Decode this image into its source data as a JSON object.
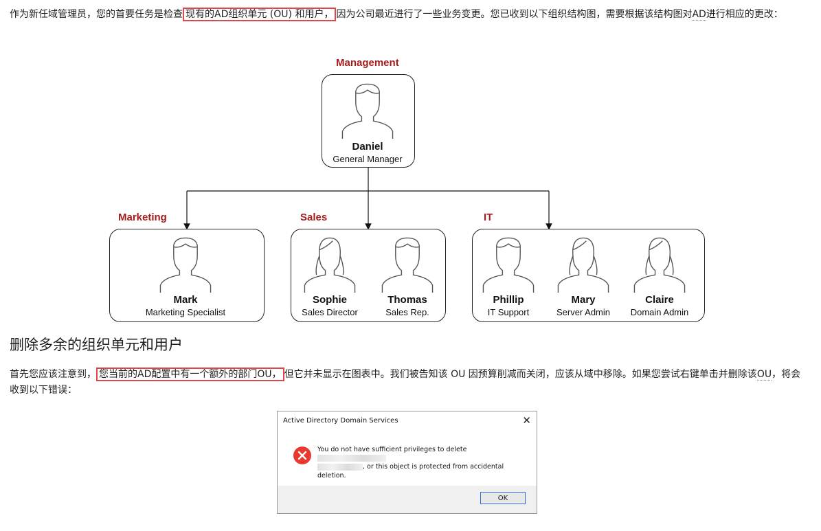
{
  "intro": {
    "before_highlight": "作为新任域管理员，您的首要任务是检查",
    "highlight_pre": "现有的",
    "highlight_ad": "AD",
    "highlight_post": "组织单元 (OU) 和用户，",
    "middle": "因为公司最近进行了一些业务变更。您已收到以下组织结构图，需要根据该结构图对",
    "ad2": "AD",
    "after": "进行相应的更改："
  },
  "org_chart": {
    "departments": [
      {
        "label": "Management"
      },
      {
        "label": "Marketing"
      },
      {
        "label": "Sales"
      },
      {
        "label": "IT"
      }
    ],
    "people": [
      {
        "name": "Daniel",
        "role": "General Manager",
        "icon": "male-avatar-icon"
      },
      {
        "name": "Mark",
        "role": "Marketing Specialist",
        "icon": "male-avatar-icon"
      },
      {
        "name": "Sophie",
        "role": "Sales Director",
        "icon": "female-avatar-icon"
      },
      {
        "name": "Thomas",
        "role": "Sales Rep.",
        "icon": "male-avatar-icon"
      },
      {
        "name": "Phillip",
        "role": "IT Support",
        "icon": "male-avatar-icon"
      },
      {
        "name": "Mary",
        "role": "Server Admin",
        "icon": "female-avatar-icon"
      },
      {
        "name": "Claire",
        "role": "Domain Admin",
        "icon": "female-avatar-icon"
      }
    ],
    "label_color": "#a61c1c"
  },
  "section": {
    "heading": "删除多余的组织单元和用户"
  },
  "para2": {
    "before": "首先您应该注意到，",
    "hl_pre": "您当前的",
    "hl_ad": "AD",
    "hl_post": "配置中有一个额外的部门",
    "hl_ou": "OU",
    "hl_end": "，",
    "after": "但它并未显示在图表中。我们被告知该 OU 因预算削减而关闭，应该从域中移除。如果您尝试右键单击并删除该",
    "ou2": "OU",
    "end": "，将会收到以下错误："
  },
  "dialog": {
    "title": "Active Directory Domain Services",
    "close": "✕",
    "message_line1": "You do not have sufficient privileges to delete",
    "message_line2": ", or this object is protected from accidental",
    "message_line3": "deletion.",
    "ok_label": "OK",
    "error_icon": "error-x-icon",
    "accent": "#e8372f"
  },
  "colors": {
    "highlight_border": "#e0454a",
    "ok_border": "#2a6fd6"
  }
}
